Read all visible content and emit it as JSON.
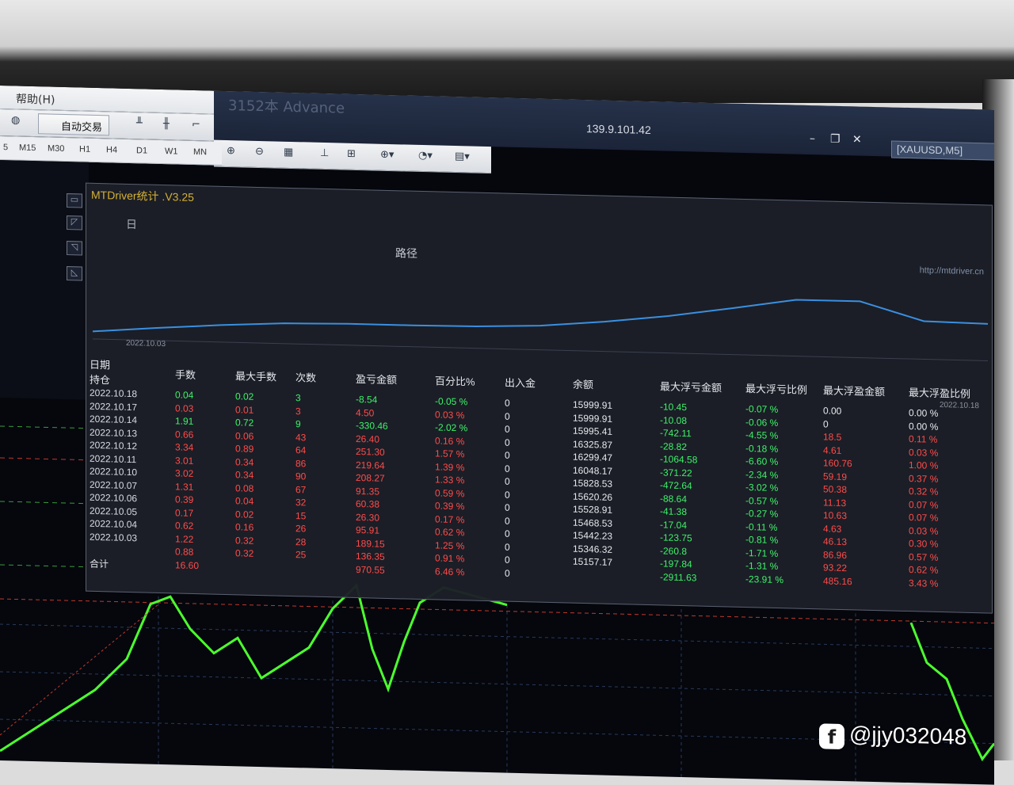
{
  "menu": {
    "help": "帮助(H)"
  },
  "title": {
    "app": "3152本 Advance",
    "ip": "139.9.101.42",
    "symbol": "[XAUUSD,M5]"
  },
  "toolbar": {
    "auto_trade": "自动交易"
  },
  "timeframes": [
    "5",
    "M15",
    "M30",
    "H1",
    "H4",
    "D1",
    "W1",
    "MN"
  ],
  "panel": {
    "title": "MTDriver统计 .V3.25",
    "tab_day": "日",
    "chart_title": "路径",
    "url": "http://mtdriver.cn",
    "date_start": "2022.10.03",
    "date_end": "2022.10.18"
  },
  "table": {
    "headers": [
      "日期",
      "手数",
      "最大手数",
      "次数",
      "盈亏金额",
      "百分比%",
      "出入金",
      "余额",
      "最大浮亏金额",
      "最大浮亏比例",
      "最大浮盈金额",
      "最大浮盈比例"
    ],
    "sub_header": "持仓",
    "rows": [
      [
        "2022.10.18",
        "0.04",
        "0.02",
        "3",
        "-8.54",
        "-0.05 %",
        "0",
        "15999.91",
        "-10.45",
        "-0.07 %",
        "0.00",
        "0.00 %"
      ],
      [
        "2022.10.17",
        "0.03",
        "0.01",
        "3",
        "4.50",
        "0.03 %",
        "0",
        "15999.91",
        "-10.08",
        "-0.06 %",
        "0",
        "0.00 %"
      ],
      [
        "2022.10.14",
        "1.91",
        "0.72",
        "9",
        "-330.46",
        "-2.02 %",
        "0",
        "15995.41",
        "-742.11",
        "-4.55 %",
        "18.5",
        "0.11 %"
      ],
      [
        "2022.10.13",
        "0.66",
        "0.06",
        "43",
        "26.40",
        "0.16 %",
        "0",
        "16325.87",
        "-28.82",
        "-0.18 %",
        "4.61",
        "0.03 %"
      ],
      [
        "2022.10.12",
        "3.34",
        "0.89",
        "64",
        "251.30",
        "1.57 %",
        "0",
        "16299.47",
        "-1064.58",
        "-6.60 %",
        "160.76",
        "1.00 %"
      ],
      [
        "2022.10.11",
        "3.01",
        "0.34",
        "86",
        "219.64",
        "1.39 %",
        "0",
        "16048.17",
        "-371.22",
        "-2.34 %",
        "59.19",
        "0.37 %"
      ],
      [
        "2022.10.10",
        "3.02",
        "0.34",
        "90",
        "208.27",
        "1.33 %",
        "0",
        "15828.53",
        "-472.64",
        "-3.02 %",
        "50.38",
        "0.32 %"
      ],
      [
        "2022.10.07",
        "1.31",
        "0.08",
        "67",
        "91.35",
        "0.59 %",
        "0",
        "15620.26",
        "-88.64",
        "-0.57 %",
        "11.13",
        "0.07 %"
      ],
      [
        "2022.10.06",
        "0.39",
        "0.04",
        "32",
        "60.38",
        "0.39 %",
        "0",
        "15528.91",
        "-41.38",
        "-0.27 %",
        "10.63",
        "0.07 %"
      ],
      [
        "2022.10.05",
        "0.17",
        "0.02",
        "15",
        "26.30",
        "0.17 %",
        "0",
        "15468.53",
        "-17.04",
        "-0.11 %",
        "4.63",
        "0.03 %"
      ],
      [
        "2022.10.04",
        "0.62",
        "0.16",
        "26",
        "95.91",
        "0.62 %",
        "0",
        "15442.23",
        "-123.75",
        "-0.81 %",
        "46.13",
        "0.30 %"
      ],
      [
        "2022.10.03",
        "1.22",
        "0.32",
        "28",
        "189.15",
        "1.25 %",
        "0",
        "15346.32",
        "-260.8",
        "-1.71 %",
        "86.96",
        "0.57 %"
      ],
      [
        "",
        "0.88",
        "0.32",
        "25",
        "136.35",
        "0.91 %",
        "0",
        "15157.17",
        "-197.84",
        "-1.31 %",
        "93.22",
        "0.62 %"
      ]
    ],
    "total": [
      "合计",
      "16.60",
      "",
      "",
      "970.55",
      "6.46 %",
      "0",
      "",
      "-2911.63",
      "-23.91 %",
      "485.16",
      "3.43 %"
    ],
    "row_colors": {
      "lots": [
        "green",
        "red",
        "green",
        "red",
        "red",
        "red",
        "red",
        "red",
        "red",
        "red",
        "red",
        "red",
        "red"
      ],
      "maxlots": [
        "green",
        "red",
        "green",
        "red",
        "red",
        "red",
        "red",
        "red",
        "red",
        "red",
        "red",
        "red",
        "red"
      ],
      "cnt": [
        "green",
        "red",
        "green",
        "red",
        "red",
        "red",
        "red",
        "red",
        "red",
        "red",
        "red",
        "red",
        "red"
      ],
      "pl": [
        "green",
        "red",
        "green",
        "red",
        "red",
        "red",
        "red",
        "red",
        "red",
        "red",
        "red",
        "red",
        "red"
      ],
      "pct": [
        "green",
        "red",
        "green",
        "red",
        "red",
        "red",
        "red",
        "red",
        "red",
        "red",
        "red",
        "red",
        "red"
      ],
      "fp": [
        "white",
        "white",
        "red",
        "red",
        "red",
        "red",
        "red",
        "red",
        "red",
        "red",
        "red",
        "red",
        "red"
      ],
      "fpp": [
        "white",
        "white",
        "red",
        "red",
        "red",
        "red",
        "red",
        "red",
        "red",
        "red",
        "red",
        "red",
        "red"
      ]
    }
  },
  "path_curve": [
    0.05,
    0.14,
    0.22,
    0.28,
    0.3,
    0.3,
    0.31,
    0.35,
    0.45,
    0.58,
    0.75,
    0.93,
    0.93,
    0.6,
    0.58
  ],
  "colors": {
    "profit": "#ff4b4b",
    "loss": "#3df26a",
    "curve": "#3a8fe0",
    "title": "#d5b035"
  },
  "watermark": "@jjy032048"
}
